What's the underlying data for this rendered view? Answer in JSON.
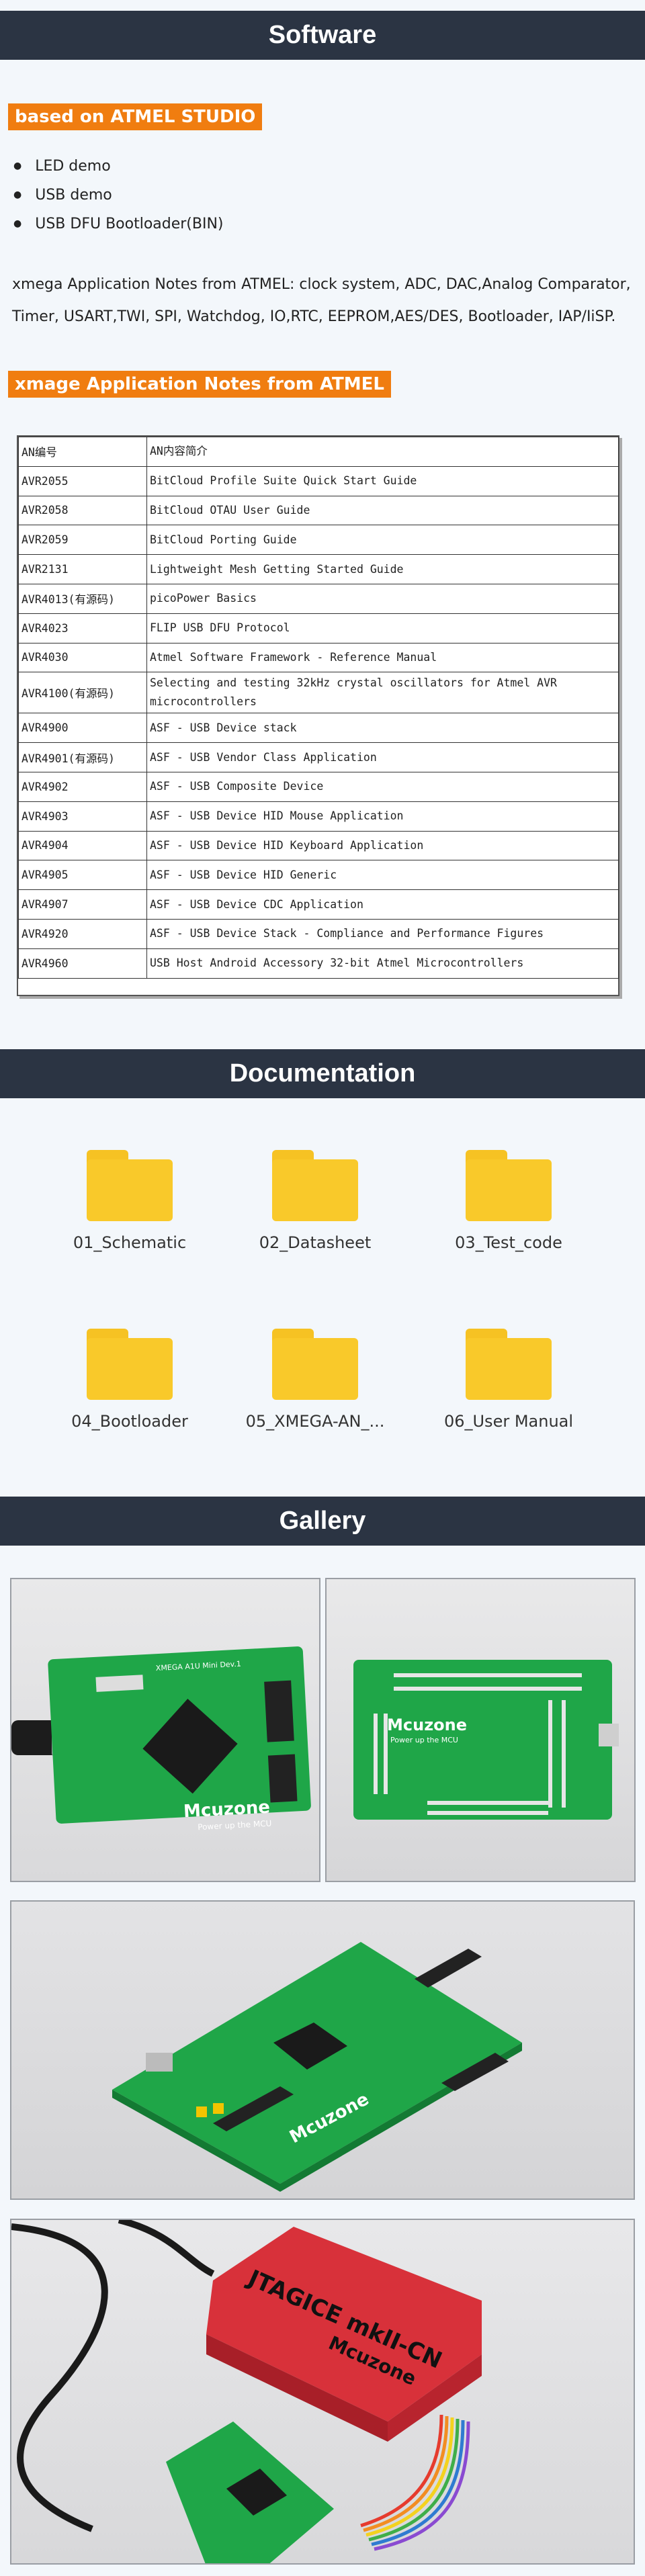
{
  "sections": {
    "software": "Software",
    "documentation": "Documentation",
    "gallery": "Gallery"
  },
  "software": {
    "tag1": "based on ATMEL STUDIO",
    "bullets": [
      "LED demo",
      "USB demo",
      "USB DFU Bootloader(BIN)"
    ],
    "paragraph": "xmega Application Notes from ATMEL: clock system, ADC, DAC,Analog Comparator, Timer, USART,TWI, SPI, Watchdog, IO,RTC,  EEPROM,AES/DES, Bootloader, IAP/IiSP.",
    "tag2": "xmage Application Notes from ATMEL"
  },
  "an_table": {
    "headers": [
      "AN编号",
      "AN内容简介"
    ],
    "rows": [
      [
        "AVR2055",
        "BitCloud Profile Suite Quick Start Guide"
      ],
      [
        "AVR2058",
        "BitCloud OTAU User Guide"
      ],
      [
        "AVR2059",
        "BitCloud Porting Guide"
      ],
      [
        "AVR2131",
        "Lightweight Mesh Getting Started Guide"
      ],
      [
        "AVR4013(有源码)",
        "picoPower Basics"
      ],
      [
        "AVR4023",
        "FLIP USB DFU Protocol"
      ],
      [
        "AVR4030",
        "Atmel Software Framework - Reference Manual"
      ],
      [
        "AVR4100(有源码)",
        "Selecting and testing 32kHz crystal oscillators for Atmel AVR microcontrollers"
      ],
      [
        "AVR4900",
        "ASF - USB Device stack"
      ],
      [
        "AVR4901(有源码)",
        "ASF - USB Vendor Class Application"
      ],
      [
        "AVR4902",
        "ASF - USB Composite Device"
      ],
      [
        "AVR4903",
        "ASF - USB Device HID Mouse Application"
      ],
      [
        "AVR4904",
        "ASF - USB Device HID Keyboard Application"
      ],
      [
        "AVR4905",
        "ASF - USB Device HID Generic"
      ],
      [
        "AVR4907",
        "ASF - USB Device CDC Application"
      ],
      [
        "AVR4920",
        "ASF - USB Device Stack - Compliance and Performance Figures"
      ],
      [
        "AVR4960",
        "USB Host Android Accessory 32-bit Atmel Microcontrollers"
      ]
    ]
  },
  "documentation": {
    "folders": [
      "01_Schematic",
      "02_Datasheet",
      "03_Test_code",
      "04_Bootloader",
      "05_XMEGA-AN_...",
      "06_User Manual"
    ],
    "folder_color": "#f9c92a"
  },
  "gallery": {
    "board_silk": "Mcuzone",
    "board_slogan": "Power up the MCU",
    "board_model": "XMEGA A1U Mini Dev.1",
    "debugger_label": "JTAGICE mkII-CN",
    "debugger_brand": "Mcuzone",
    "pcb_color": "#1fa648",
    "debugger_color": "#d8313a"
  },
  "colors": {
    "band": "#2b3443",
    "accent": "#f07d10",
    "background": "#f3f7fb"
  }
}
